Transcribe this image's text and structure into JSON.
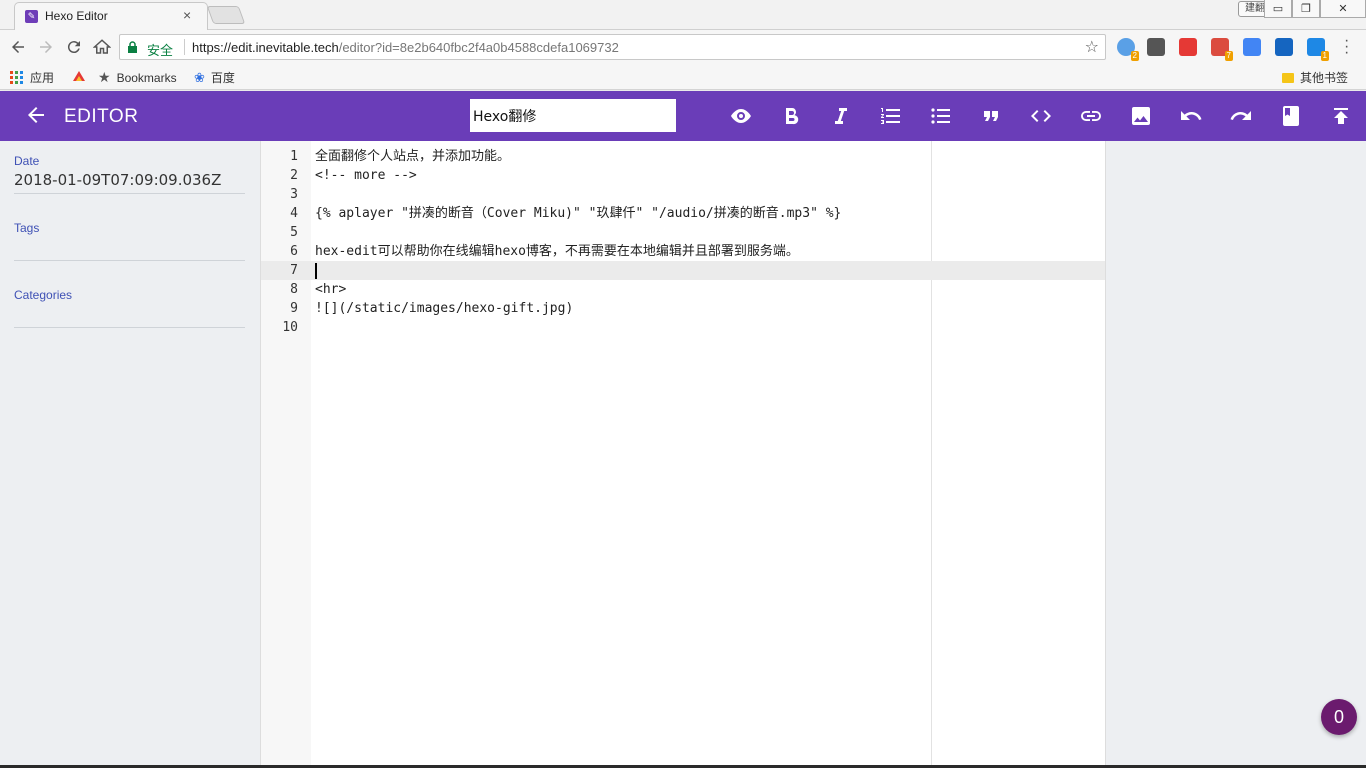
{
  "browser": {
    "tab_title": "Hexo Editor",
    "tab_close": "×",
    "ime_label": "建翻",
    "window_buttons": {
      "minimize": "▭",
      "restore": "❐",
      "close": "✕"
    },
    "secure_label": "安全",
    "url_host": "https://edit.inevitable.tech",
    "url_path": "/editor?id=8e2b640fbc2f4a0b4588cdefa1069732",
    "extensions": [
      {
        "name": "extension-blue-dot-icon",
        "badge": "2",
        "color": "#5aa0e6"
      },
      {
        "name": "pocket-icon",
        "badge": "",
        "color": "#555555"
      },
      {
        "name": "tomato-icon",
        "badge": "",
        "color": "#e53935"
      },
      {
        "name": "todoist-icon",
        "badge": "7",
        "color": "#db4c3f"
      },
      {
        "name": "translate-icon",
        "badge": "",
        "color": "#4285f4"
      },
      {
        "name": "vimium-y-icon",
        "badge": "",
        "color": "#1565c0"
      },
      {
        "name": "skype-icon",
        "badge": "1",
        "color": "#1e88e5"
      }
    ]
  },
  "bookmarks": {
    "apps": "应用",
    "bookmarks": "Bookmarks",
    "baidu": "百度",
    "other": "其他书签"
  },
  "appbar": {
    "title": "EDITOR",
    "post_title": "Hexo翻修",
    "accent": "#6a3db8"
  },
  "meta": {
    "date_label": "Date",
    "date_value": "2018-01-09T07:09:09.036Z",
    "tags_label": "Tags",
    "categories_label": "Categories"
  },
  "editor": {
    "lines": [
      {
        "n": "1",
        "text": "全面翻修个人站点，并添加功能。"
      },
      {
        "n": "2",
        "text": "<!-- more -->"
      },
      {
        "n": "3",
        "text": ""
      },
      {
        "n": "4",
        "text": "{% aplayer \"拼凑的断音（Cover Miku)\" \"玖肆仟\" \"/audio/拼凑的断音.mp3\" %}"
      },
      {
        "n": "5",
        "text": ""
      },
      {
        "n": "6",
        "text": "hex-edit可以帮助你在线编辑hexo博客，不再需要在本地编辑并且部署到服务端。"
      },
      {
        "n": "7",
        "text": ""
      },
      {
        "n": "8",
        "text": "<hr>"
      },
      {
        "n": "9",
        "text": "![](/static/images/hexo-gift.jpg)"
      },
      {
        "n": "10",
        "text": ""
      }
    ]
  },
  "badge_count": "0"
}
